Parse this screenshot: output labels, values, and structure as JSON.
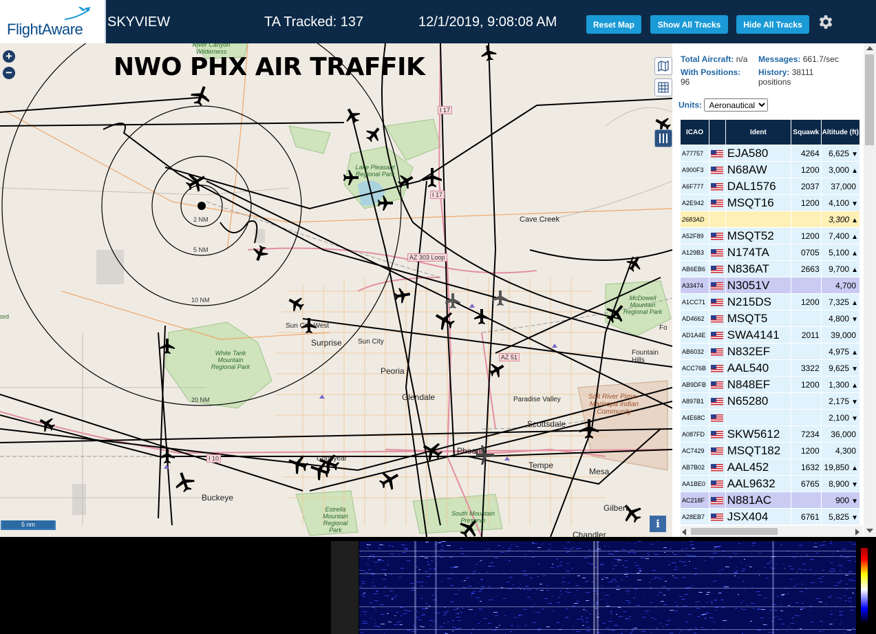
{
  "header": {
    "brand": "FlightAware",
    "app_title": "SKYVIEW",
    "tracked": "TA Tracked: 137",
    "datetime": "12/1/2019, 9:08:08 AM",
    "buttons": {
      "reset_map": "Reset Map",
      "show_all": "Show All Tracks",
      "hide_all": "Hide All Tracks"
    }
  },
  "map": {
    "title": "NWO PHX AIR TRAFFIK",
    "zoom_in": "+",
    "zoom_out": "−",
    "scale_label": "5 nm",
    "info": "i",
    "range_rings": [
      "2 NM",
      "5 NM",
      "10 NM",
      "20 NM"
    ],
    "highway_labels": [
      "I 17",
      "I 17",
      "AZ 303 Loop",
      "I 10",
      "AZ 51"
    ],
    "areas": [
      "River Canyon Wilderness",
      "Lake Pleasant Regional Park",
      "White Tank Mountain Regional Park",
      "McDowell Mountain Regional Park",
      "Salt River Pima - Maricopa Indian Community",
      "South Mountain Preserve",
      "Estrella Mountain Regional Park"
    ],
    "places": [
      "Cave Creek",
      "Sun City West",
      "Surprise",
      "Sun City",
      "Peoria",
      "Glendale",
      "Paradise Valley",
      "Scottsdale",
      "Fountain Hills",
      "Goodyear",
      "Phoenix",
      "Tempe",
      "Mesa",
      "Gilbert",
      "Chandler",
      "Buckeye"
    ],
    "edge_labels": [
      "ord",
      "Fo"
    ]
  },
  "sidebar": {
    "total_label": "Total Aircraft:",
    "total_value": "n/a",
    "messages_label": "Messages:",
    "messages_value": "661.7/sec",
    "with_pos_label": "With Positions:",
    "with_pos_value": "96",
    "history_label": "History:",
    "history_value": "38111 positions",
    "units_label": "Units:",
    "units_value": "Aeronautical",
    "columns": [
      "ICAO",
      "",
      "Ident",
      "Squawk",
      "Altitude (ft)"
    ],
    "rows": [
      {
        "icao": "A77757",
        "ident": "EJA580",
        "squawk": "4264",
        "alt": "6,625",
        "trend": "▼"
      },
      {
        "icao": "A900F3",
        "ident": "N68AW",
        "squawk": "1200",
        "alt": "3,000",
        "trend": "▲"
      },
      {
        "icao": "A6F777",
        "ident": "DAL1576",
        "squawk": "2037",
        "alt": "37,000",
        "trend": ""
      },
      {
        "icao": "A2E942",
        "ident": "MSQT16",
        "squawk": "1200",
        "alt": "4,100",
        "trend": "▼"
      },
      {
        "icao": "2683AD",
        "ident": "",
        "squawk": "",
        "alt": "3,300",
        "trend": "▲",
        "style": "yel",
        "noflag": true
      },
      {
        "icao": "A52F89",
        "ident": "MSQT52",
        "squawk": "1200",
        "alt": "7,400",
        "trend": "▲"
      },
      {
        "icao": "A129B3",
        "ident": "N174TA",
        "squawk": "0705",
        "alt": "5,100",
        "trend": "▲"
      },
      {
        "icao": "AB6EB6",
        "ident": "N836AT",
        "squawk": "2663",
        "alt": "9,700",
        "trend": "▲"
      },
      {
        "icao": "A33474",
        "ident": "N3051V",
        "squawk": "",
        "alt": "4,700",
        "trend": "",
        "style": "sel"
      },
      {
        "icao": "A1CC71",
        "ident": "N215DS",
        "squawk": "1200",
        "alt": "7,325",
        "trend": "▲"
      },
      {
        "icao": "AD4662",
        "ident": "MSQT5",
        "squawk": "",
        "alt": "4,800",
        "trend": "▼"
      },
      {
        "icao": "AD1A4E",
        "ident": "SWA4141",
        "squawk": "2011",
        "alt": "39,000",
        "trend": ""
      },
      {
        "icao": "AB6032",
        "ident": "N832EF",
        "squawk": "",
        "alt": "4,975",
        "trend": "▲"
      },
      {
        "icao": "ACC76B",
        "ident": "AAL540",
        "squawk": "3322",
        "alt": "9,625",
        "trend": "▼"
      },
      {
        "icao": "AB9DFB",
        "ident": "N848EF",
        "squawk": "1200",
        "alt": "1,300",
        "trend": "▲"
      },
      {
        "icao": "A897B1",
        "ident": "N65280",
        "squawk": "",
        "alt": "2,175",
        "trend": "▼"
      },
      {
        "icao": "A4E68C",
        "ident": "",
        "squawk": "",
        "alt": "2,100",
        "trend": "▼"
      },
      {
        "icao": "A087FD",
        "ident": "SKW5612",
        "squawk": "7234",
        "alt": "36,000",
        "trend": ""
      },
      {
        "icao": "AC7429",
        "ident": "MSQT182",
        "squawk": "1200",
        "alt": "4,300",
        "trend": ""
      },
      {
        "icao": "AB7B02",
        "ident": "AAL452",
        "squawk": "1632",
        "alt": "19,850",
        "trend": "▲"
      },
      {
        "icao": "AA1BE0",
        "ident": "AAL9632",
        "squawk": "6765",
        "alt": "8,900",
        "trend": "▼"
      },
      {
        "icao": "AC218F",
        "ident": "N881AC",
        "squawk": "",
        "alt": "900",
        "trend": "▼",
        "style": "sel"
      },
      {
        "icao": "A28EB7",
        "ident": "JSX404",
        "squawk": "6761",
        "alt": "5,825",
        "trend": "▼"
      }
    ]
  },
  "icons": {
    "gear": "gear-icon",
    "layers": "map-layers-icon",
    "grid": "grid-icon",
    "columns": "column-toggle-icon"
  },
  "colors": {
    "header_bg": "#0c2a48",
    "button": "#1a9ad6",
    "row_bg": "#e0f2fc",
    "row_selected": "#c9cbf3",
    "row_highlight": "#fff0b6",
    "waterfall_bg": "#050a56"
  }
}
